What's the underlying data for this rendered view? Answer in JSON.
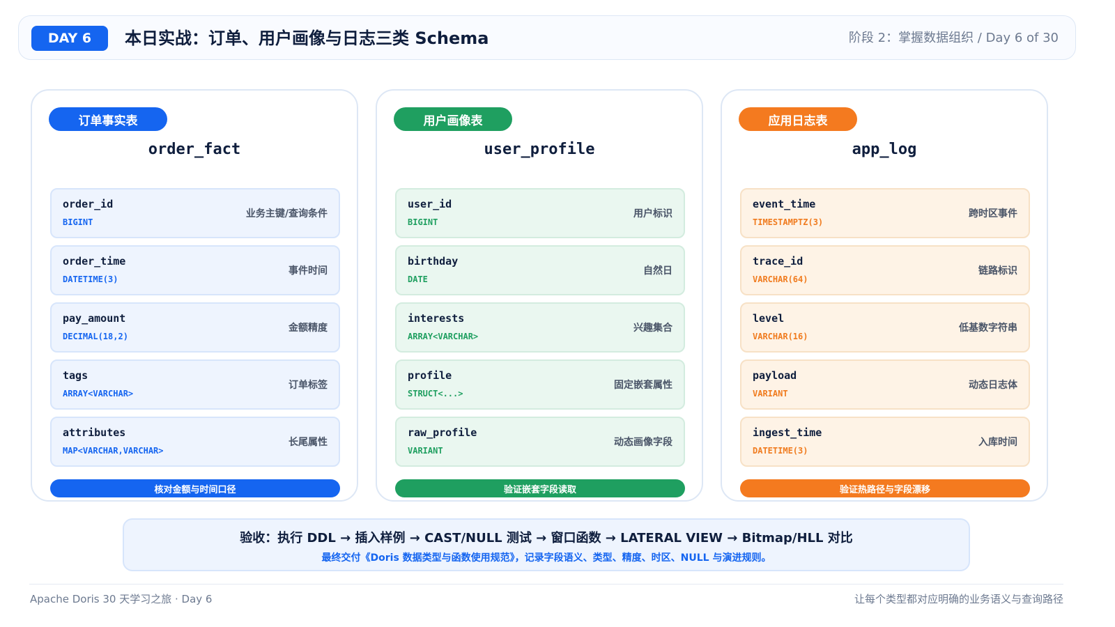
{
  "header": {
    "day_badge": "DAY 6",
    "title": "本日实战：订单、用户画像与日志三类 Schema",
    "stage": "阶段 2：掌握数据组织 / Day 6 of 30"
  },
  "colors": {
    "blue": "#1565f0",
    "green": "#1f9f60",
    "orange": "#f47a1f"
  },
  "cards": [
    {
      "pill": "订单事实表",
      "table": "order_fact",
      "fields": [
        {
          "name": "order_id",
          "type": "BIGINT",
          "desc": "业务主键/查询条件"
        },
        {
          "name": "order_time",
          "type": "DATETIME(3)",
          "desc": "事件时间"
        },
        {
          "name": "pay_amount",
          "type": "DECIMAL(18,2)",
          "desc": "金额精度"
        },
        {
          "name": "tags",
          "type": "ARRAY<VARCHAR>",
          "desc": "订单标签"
        },
        {
          "name": "attributes",
          "type": "MAP<VARCHAR,VARCHAR>",
          "desc": "长尾属性"
        }
      ],
      "footer": "核对金额与时间口径"
    },
    {
      "pill": "用户画像表",
      "table": "user_profile",
      "fields": [
        {
          "name": "user_id",
          "type": "BIGINT",
          "desc": "用户标识"
        },
        {
          "name": "birthday",
          "type": "DATE",
          "desc": "自然日"
        },
        {
          "name": "interests",
          "type": "ARRAY<VARCHAR>",
          "desc": "兴趣集合"
        },
        {
          "name": "profile",
          "type": "STRUCT<...>",
          "desc": "固定嵌套属性"
        },
        {
          "name": "raw_profile",
          "type": "VARIANT",
          "desc": "动态画像字段"
        }
      ],
      "footer": "验证嵌套字段读取"
    },
    {
      "pill": "应用日志表",
      "table": "app_log",
      "fields": [
        {
          "name": "event_time",
          "type": "TIMESTAMPTZ(3)",
          "desc": "跨时区事件"
        },
        {
          "name": "trace_id",
          "type": "VARCHAR(64)",
          "desc": "链路标识"
        },
        {
          "name": "level",
          "type": "VARCHAR(16)",
          "desc": "低基数字符串"
        },
        {
          "name": "payload",
          "type": "VARIANT",
          "desc": "动态日志体"
        },
        {
          "name": "ingest_time",
          "type": "DATETIME(3)",
          "desc": "入库时间"
        }
      ],
      "footer": "验证热路径与字段漂移"
    }
  ],
  "summary": {
    "main": "验收：执行 DDL → 插入样例 → CAST/NULL 测试 → 窗口函数 → LATERAL VIEW → Bitmap/HLL 对比",
    "sub": "最终交付《Doris 数据类型与函数使用规范》，记录字段语义、类型、精度、时区、NULL 与演进规则。"
  },
  "footer": {
    "left": "Apache Doris 30 天学习之旅 · Day 6",
    "right": "让每个类型都对应明确的业务语义与查询路径"
  }
}
